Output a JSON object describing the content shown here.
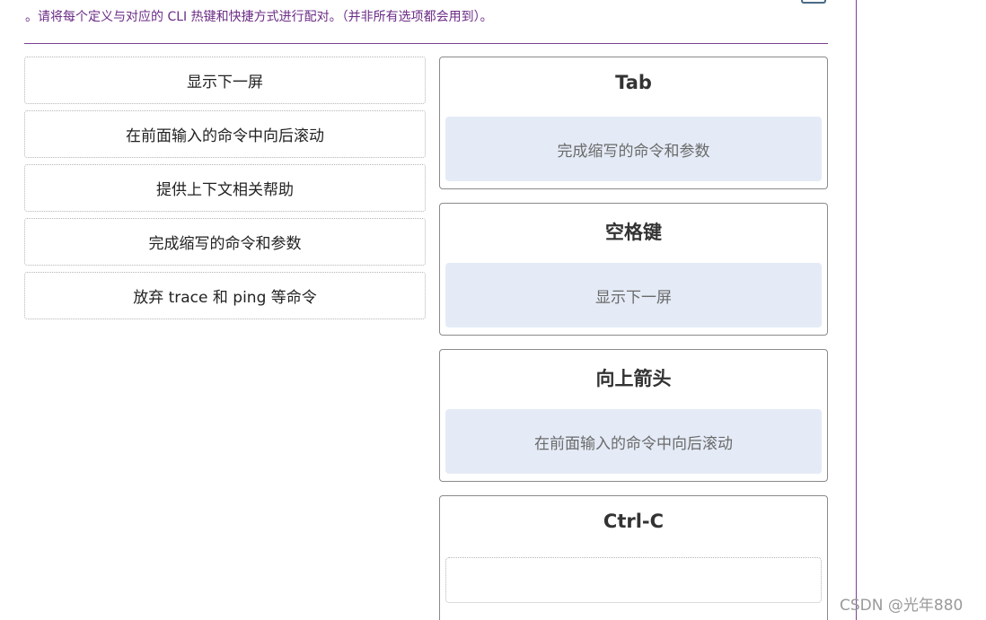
{
  "instructions": "。请将每个定义与对应的 CLI 热键和快捷方式进行配对。（并非所有选项都会用到）。",
  "options": [
    "显示下一屏",
    "在前面输入的命令中向后滚动",
    "提供上下文相关帮助",
    "完成缩写的命令和参数",
    "放弃 trace 和 ping 等命令"
  ],
  "targets": [
    {
      "title": "Tab",
      "answer": "完成缩写的命令和参数"
    },
    {
      "title": "空格键",
      "answer": "显示下一屏"
    },
    {
      "title": "向上箭头",
      "answer": "在前面输入的命令中向后滚动"
    },
    {
      "title": "Ctrl-C",
      "answer": ""
    }
  ],
  "watermark": "CSDN @光年880",
  "colors": {
    "instruction_text": "#6b2c86",
    "divider": "#7b3f91",
    "filled_drop": "#e4ebf6"
  }
}
